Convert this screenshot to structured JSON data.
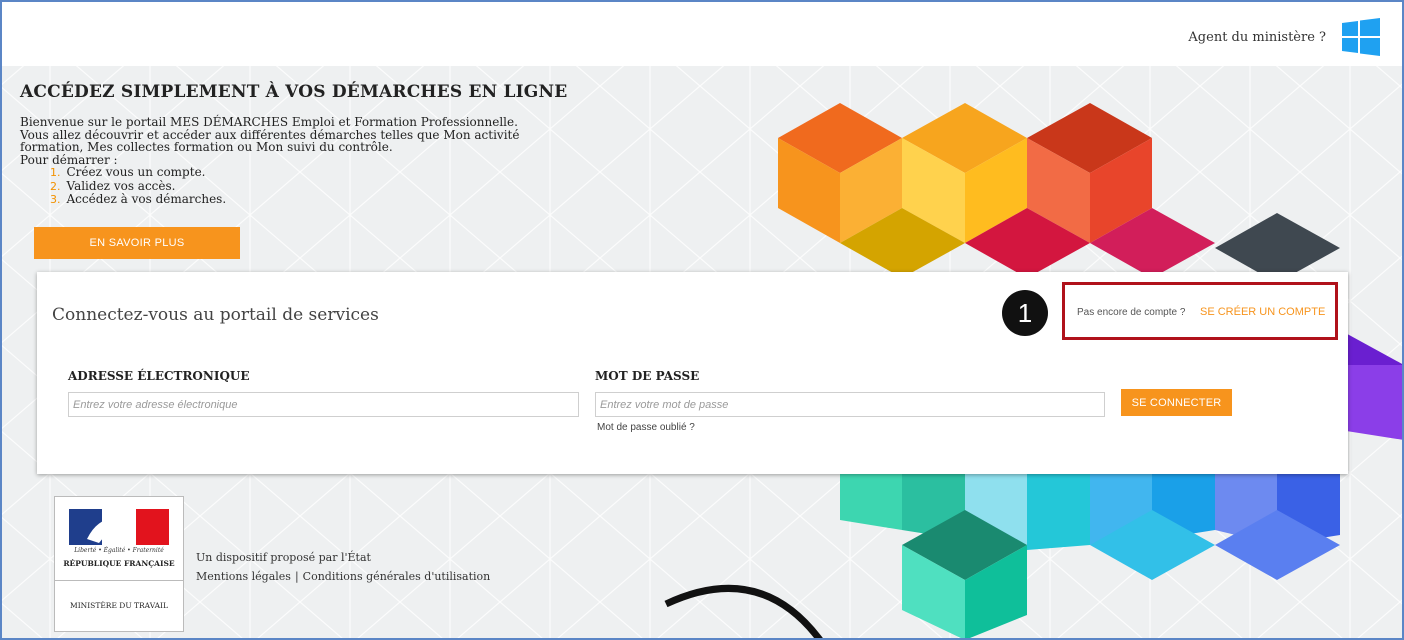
{
  "topbar": {
    "agent_link": "Agent du ministère ?",
    "windows_icon": "windows-logo-icon"
  },
  "intro": {
    "title": "ACCÉDEZ SIMPLEMENT À VOS DÉMARCHES EN LIGNE",
    "paragraph_lines": [
      "Bienvenue sur le portail MES DÉMARCHES Emploi et Formation Professionnelle.",
      "Vous allez découvrir et accéder aux différentes démarches telles que Mon activité",
      "formation, Mes collectes formation ou Mon suivi du contrôle.",
      "Pour démarrer :"
    ],
    "steps": [
      {
        "num": "1.",
        "text": "Créez vous un compte."
      },
      {
        "num": "2.",
        "text": "Validez vos accès."
      },
      {
        "num": "3.",
        "text": "Accédez à vos démarches."
      }
    ],
    "learn_more_label": "EN SAVOIR PLUS"
  },
  "login": {
    "title": "Connectez-vous au portail de services",
    "no_account_text": "Pas encore de compte ?",
    "create_account_label": "SE CRÉER UN COMPTE",
    "step_badge": "1",
    "email_label": "ADRESSE ÉLECTRONIQUE",
    "email_placeholder": "Entrez votre adresse électronique",
    "email_value": "",
    "password_label": "MOT DE PASSE",
    "password_placeholder": "Entrez votre mot de passe",
    "password_value": "",
    "forgot_label": "Mot de passe oublié ?",
    "connect_label": "SE CONNECTER"
  },
  "logo": {
    "motto": "Liberté • Égalité • Fraternité",
    "republic": "RÉPUBLIQUE FRANÇAISE",
    "ministry": "MINISTÈRE DU TRAVAIL"
  },
  "footer": {
    "tagline": "Un dispositif proposé par l'État",
    "legal_label": "Mentions légales",
    "separator": "|",
    "terms_label": "Conditions générales d'utilisation"
  },
  "colors": {
    "accent_orange": "#f7941d",
    "highlight_red": "#b0121b",
    "frame_blue": "#5b86c6",
    "windows_blue": "#1fa1f1"
  }
}
